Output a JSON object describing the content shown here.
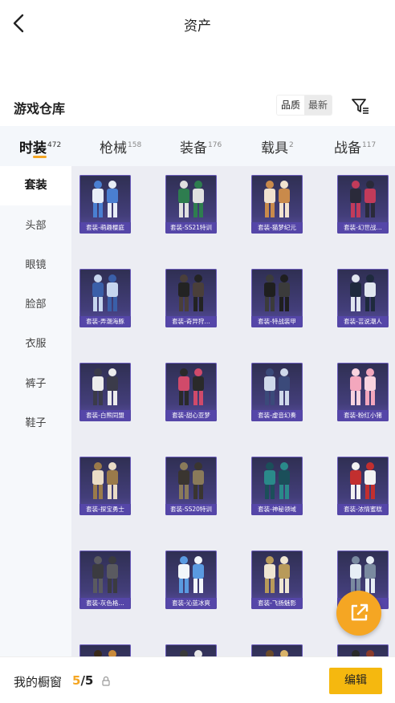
{
  "header": {
    "title": "资产"
  },
  "warehouse": {
    "title": "游戏仓库",
    "sort": {
      "quality": "品质",
      "latest": "最新",
      "selected": "品质"
    }
  },
  "tabs": [
    {
      "label": "时装",
      "count": "472",
      "active": true
    },
    {
      "label": "枪械",
      "count": "158",
      "active": false
    },
    {
      "label": "装备",
      "count": "176",
      "active": false
    },
    {
      "label": "载具",
      "count": "2",
      "active": false
    },
    {
      "label": "战备",
      "count": "117",
      "active": false
    }
  ],
  "sidebar": {
    "items": [
      {
        "label": "套装",
        "active": true
      },
      {
        "label": "头部",
        "active": false
      },
      {
        "label": "眼镜",
        "active": false
      },
      {
        "label": "脸部",
        "active": false
      },
      {
        "label": "衣服",
        "active": false
      },
      {
        "label": "裤子",
        "active": false
      },
      {
        "label": "鞋子",
        "active": false
      }
    ]
  },
  "items": [
    {
      "label": "套装-萌趣樱庭",
      "colors": [
        "#e8eef7",
        "#4a7fd1"
      ]
    },
    {
      "label": "套装-SS21特训",
      "colors": [
        "#2e7d4f",
        "#e0e0e0"
      ]
    },
    {
      "label": "套装-猫梦纪元",
      "colors": [
        "#f1e2cf",
        "#c98a4b"
      ]
    },
    {
      "label": "套装-幻世战…",
      "colors": [
        "#2a2a3a",
        "#c23b5a"
      ]
    },
    {
      "label": "套装-弄潮海豚",
      "colors": [
        "#3a5fa8",
        "#c7d6ee"
      ]
    },
    {
      "label": "套装-奇异狩…",
      "colors": [
        "#232323",
        "#4a3f3a"
      ]
    },
    {
      "label": "套装-特战装甲",
      "colors": [
        "#1f1f1f",
        "#3b3b3b"
      ]
    },
    {
      "label": "套装-芸说潮人",
      "colors": [
        "#1e2a3d",
        "#e0e6ef"
      ]
    },
    {
      "label": "套装-白熊同盟",
      "colors": [
        "#ececec",
        "#3b3b4a"
      ]
    },
    {
      "label": "套装-甜心亚梦",
      "colors": [
        "#d04a6a",
        "#2a2a2a"
      ]
    },
    {
      "label": "套装-虚音幻奏",
      "colors": [
        "#cfd9ea",
        "#3b4a7a"
      ]
    },
    {
      "label": "套装-粉红小猪",
      "colors": [
        "#f3a7bd",
        "#f8d3df"
      ]
    },
    {
      "label": "套装-探宝勇士",
      "colors": [
        "#eadcc6",
        "#9a7a4a"
      ]
    },
    {
      "label": "套装-SS20特训",
      "colors": [
        "#3a3530",
        "#8a7a5a"
      ]
    },
    {
      "label": "套装-神秘领域",
      "colors": [
        "#2a8a8a",
        "#1b4f5a"
      ]
    },
    {
      "label": "套装-浓情蜜糕",
      "colors": [
        "#c22f2f",
        "#f2f2f2"
      ]
    },
    {
      "label": "套装-灰色格…",
      "colors": [
        "#3b3b40",
        "#5a5a60"
      ]
    },
    {
      "label": "套装-沁蓝冰爽",
      "colors": [
        "#f2f6fa",
        "#5a9ae0"
      ]
    },
    {
      "label": "套装-飞扬魅影",
      "colors": [
        "#efe6d2",
        "#b89a5a"
      ]
    },
    {
      "label": "套装-…光",
      "colors": [
        "#e7eef5",
        "#7a8aa0"
      ]
    },
    {
      "label": "",
      "colors": [
        "#c98a3a",
        "#3a2a1a"
      ]
    },
    {
      "label": "",
      "colors": [
        "#e8e8e8",
        "#3a3a3a"
      ]
    },
    {
      "label": "",
      "colors": [
        "#d9b36a",
        "#6a4a2a"
      ]
    },
    {
      "label": "",
      "colors": [
        "#8a3a2a",
        "#2a2a2a"
      ]
    }
  ],
  "showcase": {
    "label": "我的橱窗",
    "current": "5",
    "total": "/5"
  },
  "edit_label": "编辑",
  "icons": {
    "back": "chevron-left-icon",
    "filter": "filter-icon",
    "share": "share-icon",
    "lock": "lock-icon"
  },
  "colors": {
    "accent": "#f5a623",
    "card_bg": "#433e7a",
    "card_label_bg": "#5546a8"
  }
}
